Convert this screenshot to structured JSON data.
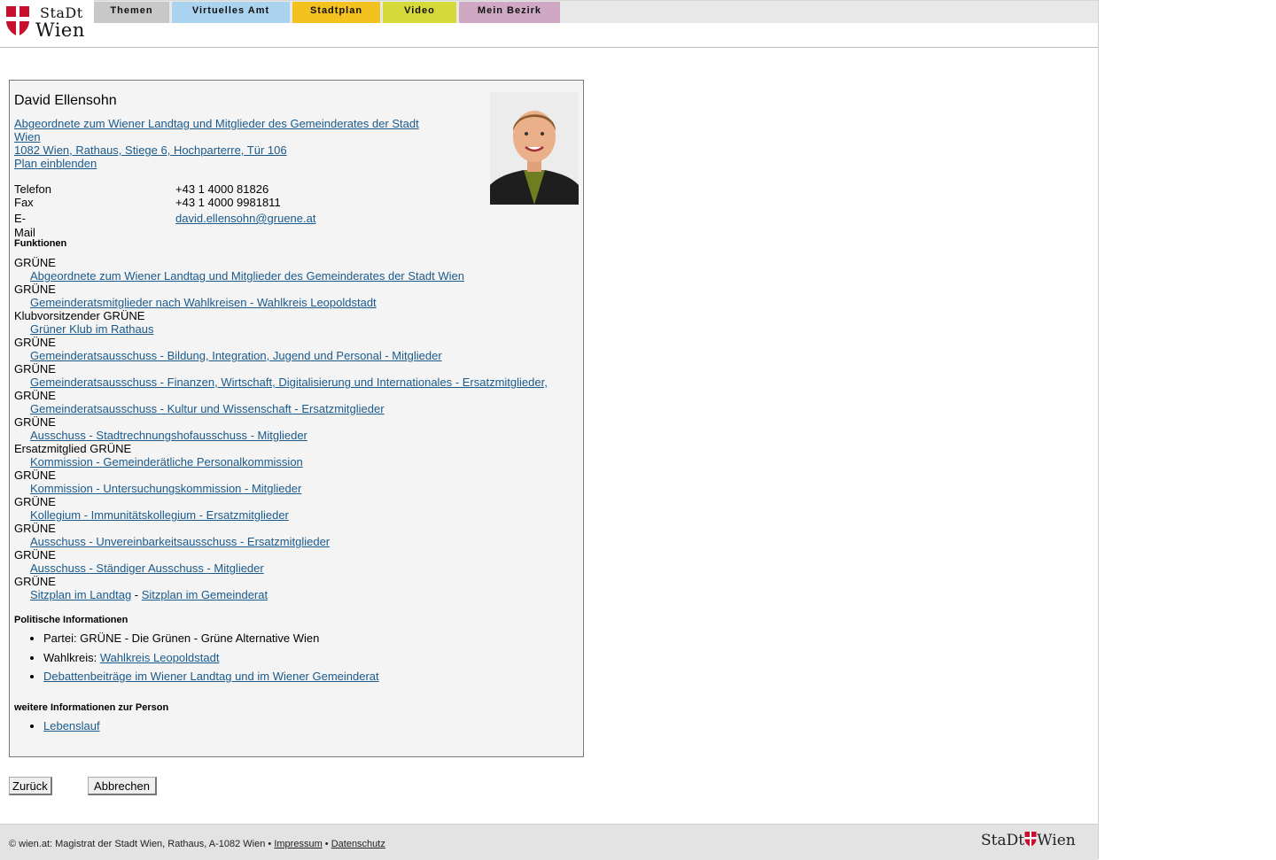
{
  "logo": {
    "line1": "StaDt",
    "line2": "Wien"
  },
  "nav": {
    "tabs": [
      {
        "label": "Themen",
        "color": "#c8c8c8"
      },
      {
        "label": "Virtuelles Amt",
        "color": "#a9d3ef"
      },
      {
        "label": "Stadtplan",
        "color": "#f3c21f"
      },
      {
        "label": "Video",
        "color": "#d6d93a"
      },
      {
        "label": "Mein Bezirk",
        "color": "#cfa9c4"
      }
    ]
  },
  "person": {
    "name": "David Ellensohn",
    "address_line1": "Abgeordnete zum Wiener Landtag und Mitglieder des Gemeinderates der Stadt Wien",
    "address_line2": "1082 Wien, Rathaus, Stiege 6, Hochparterre, Tür 106",
    "map_link": "Plan einblenden",
    "contacts": [
      {
        "label": "Telefon",
        "value": "+43 1 4000 81826"
      },
      {
        "label": "Fax",
        "value": "+43 1 4000 9981811"
      },
      {
        "label": "E-Mail",
        "value": "david.ellensohn@gruene.at"
      }
    ]
  },
  "functions": {
    "heading": "Funktionen",
    "items": [
      {
        "role": "GRÜNE",
        "link": "Abgeordnete zum Wiener Landtag und Mitglieder des Gemeinderates der Stadt Wien"
      },
      {
        "role": "GRÜNE",
        "link": "Gemeinderatsmitglieder nach Wahlkreisen - Wahlkreis Leopoldstadt"
      },
      {
        "role": "Klubvorsitzender GRÜNE",
        "link": "Grüner Klub im Rathaus"
      },
      {
        "role": "GRÜNE",
        "link": "Gemeinderatsausschuss - Bildung, Integration, Jugend und Personal - Mitglieder"
      },
      {
        "role": "GRÜNE",
        "link": "Gemeinderatsausschuss - Finanzen, Wirtschaft, Digitalisierung und Internationales - Ersatzmitglieder,"
      },
      {
        "role": "GRÜNE",
        "link": "Gemeinderatsausschuss - Kultur und Wissenschaft - Ersatzmitglieder"
      },
      {
        "role": "GRÜNE",
        "link": "Ausschuss - Stadtrechnungshofausschuss - Mitglieder"
      },
      {
        "role": "Ersatzmitglied GRÜNE",
        "link": "Kommission - Gemeinderätliche Personalkommission"
      },
      {
        "role": "GRÜNE",
        "link": "Kommission - Untersuchungskommission - Mitglieder"
      },
      {
        "role": "GRÜNE",
        "link": "Kollegium - Immunitätskollegium - Ersatzmitglieder"
      },
      {
        "role": "GRÜNE",
        "link": "Ausschuss - Unvereinbarkeitsausschuss - Ersatzmitglieder"
      },
      {
        "role": "GRÜNE",
        "link": "Ausschuss - Ständiger Ausschuss - Mitglieder"
      }
    ],
    "last_role": "GRÜNE",
    "seat_link_1": "Sitzplan im Landtag",
    "seat_sep": " - ",
    "seat_link_2": "Sitzplan im Gemeinderat"
  },
  "political": {
    "heading": "Politische Informationen",
    "party": "Partei: GRÜNE - Die Grünen - Grüne Alternative Wien",
    "district_label": "Wahlkreis: ",
    "district_link": "Wahlkreis Leopoldstadt",
    "debate_link": "Debattenbeiträge im Wiener Landtag und im Wiener Gemeinderat"
  },
  "more": {
    "heading": "weitere Informationen zur Person",
    "cv_link": "Lebenslauf"
  },
  "buttons": {
    "back": "Zurück",
    "cancel": "Abbrechen"
  },
  "footer": {
    "copyright": "© wien.at: Magistrat der Stadt Wien, Rathaus, A-1082 Wien • ",
    "impressum": "Impressum",
    "bullet": " • ",
    "datenschutz": "Datenschutz",
    "logo_left": "StaDt",
    "logo_right": "Wien"
  },
  "colors": {
    "link": "#1a5a8c",
    "brand_red": "#c8102e"
  }
}
